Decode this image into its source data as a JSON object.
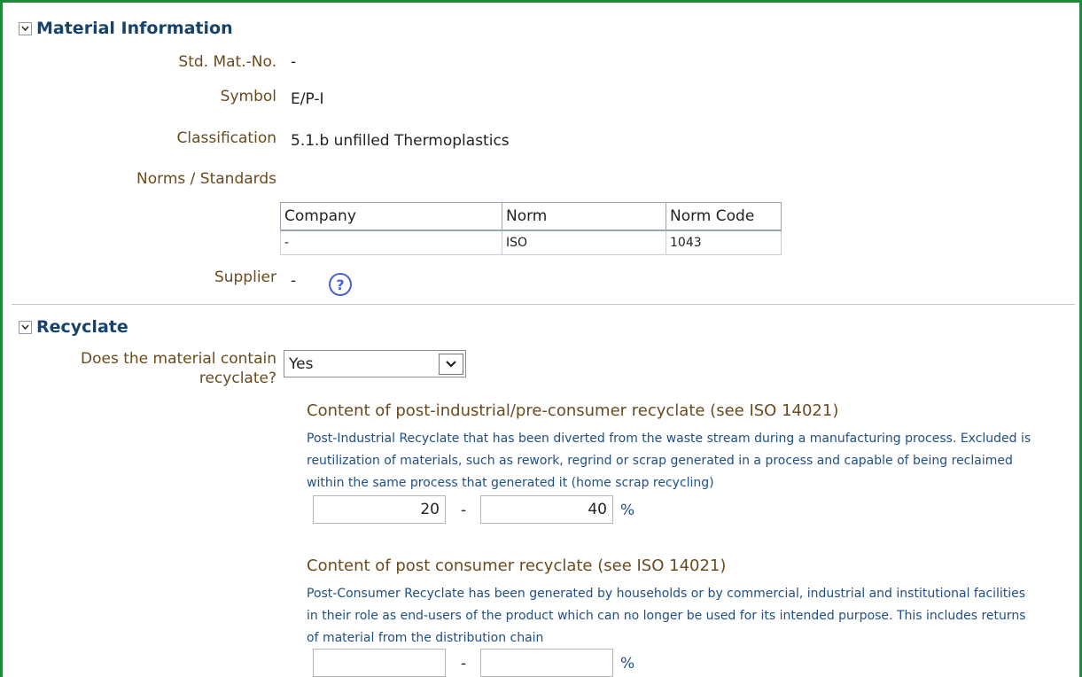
{
  "material_info": {
    "title": "Material Information",
    "fields": {
      "std_mat_no_label": "Std. Mat.-No.",
      "std_mat_no_value": "-",
      "symbol_label": "Symbol",
      "symbol_value": "E/P-I",
      "classification_label": "Classification",
      "classification_value": "5.1.b unfilled Thermoplastics",
      "norms_label": "Norms / Standards",
      "supplier_label": "Supplier",
      "supplier_value": "-"
    },
    "norms_table": {
      "headers": [
        "Company",
        "Norm",
        "Norm Code"
      ],
      "rows": [
        [
          "-",
          "ISO",
          "1043"
        ]
      ]
    },
    "help_icon_glyph": "?"
  },
  "recyclate": {
    "title": "Recyclate",
    "contains_label_line1": "Does the material contain",
    "contains_label_line2": "recyclate?",
    "contains_value": "Yes",
    "post_industrial": {
      "title": "Content of post-industrial/pre-consumer recyclate (see ISO 14021)",
      "description_lines": [
        "Post-Industrial Recyclate that has been diverted from the waste stream during a manufacturing process. Excluded is",
        "reutilization of materials, such as rework, regrind or scrap generated in a process and capable of being reclaimed",
        "within the same process that generated it (home scrap recycling)"
      ],
      "min": "20",
      "max": "40",
      "separator": "-",
      "unit": "%"
    },
    "post_consumer": {
      "title": "Content of post consumer recyclate (see ISO 14021)",
      "description_lines": [
        "Post-Consumer Recyclate has been generated by households or by commercial, industrial and institutional facilities",
        "in their role as end-users of the product which can no longer be used for its intended purpose. This includes returns",
        "of material from the distribution chain"
      ],
      "min": "",
      "max": "",
      "separator": "-",
      "unit": "%"
    }
  },
  "colors": {
    "frame_border": "#1e8a3c",
    "section_title": "#16426e",
    "label": "#6b4a1e",
    "description": "#1f4f86",
    "help_icon": "#4a60d8"
  }
}
